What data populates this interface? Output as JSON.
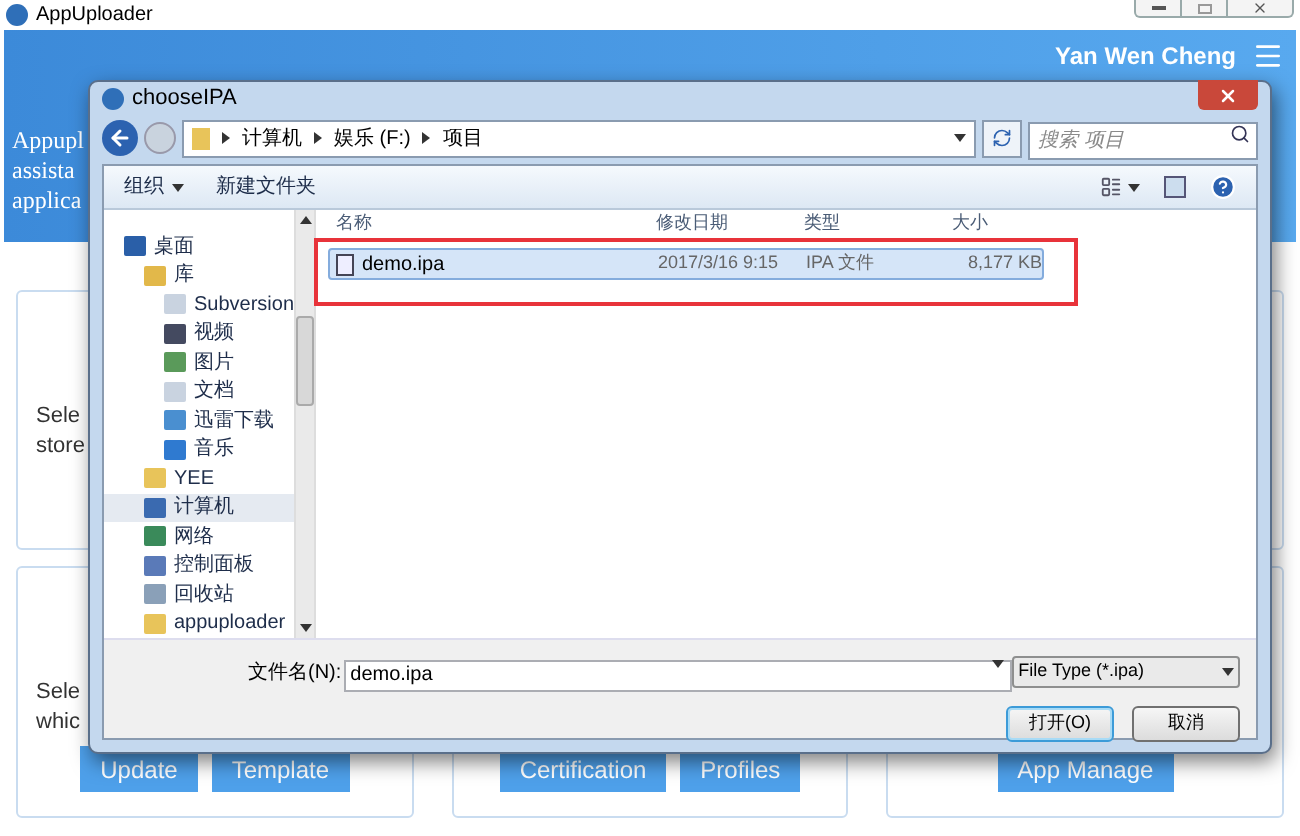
{
  "app": {
    "title": "AppUploader",
    "user": "Yan Wen Cheng",
    "intro_lines": [
      "Appupl",
      "assista",
      "applica"
    ],
    "rows": [
      {
        "cards": [
          {
            "lines": [
              "Sele",
              "store"
            ]
          }
        ]
      },
      {
        "cards": [
          {
            "lines": [
              "Sele",
              "whic"
            ],
            "buttons": [
              "Update",
              "Template"
            ]
          },
          {
            "buttons": [
              "Certification",
              "Profiles"
            ]
          },
          {
            "buttons": [
              "App Manage"
            ]
          }
        ]
      }
    ]
  },
  "dialog": {
    "title": "chooseIPA",
    "path": [
      "计算机",
      "娱乐 (F:)",
      "项目"
    ],
    "search_placeholder": "搜索 项目",
    "toolbar": [
      {
        "label": "组织",
        "kind": "menu"
      },
      {
        "label": "新建文件夹",
        "kind": "button"
      }
    ],
    "nav": [
      {
        "label": "桌面",
        "kind": "desktop",
        "selected": false,
        "children": [
          {
            "label": "库",
            "kind": "library",
            "selected": false,
            "children": [
              {
                "label": "Subversion",
                "kind": "document",
                "selected": false
              },
              {
                "label": "视频",
                "kind": "video",
                "selected": false
              },
              {
                "label": "图片",
                "kind": "picture",
                "selected": false
              },
              {
                "label": "文档",
                "kind": "document",
                "selected": false
              },
              {
                "label": "迅雷下载",
                "kind": "download",
                "selected": false
              },
              {
                "label": "音乐",
                "kind": "music",
                "selected": false
              }
            ]
          },
          {
            "label": "YEE",
            "kind": "folder",
            "selected": false
          },
          {
            "label": "计算机",
            "kind": "computer",
            "selected": true
          },
          {
            "label": "网络",
            "kind": "network",
            "selected": false
          },
          {
            "label": "控制面板",
            "kind": "control-panel",
            "selected": false
          },
          {
            "label": "回收站",
            "kind": "recycle-bin",
            "selected": false
          },
          {
            "label": "appuploader",
            "kind": "folder",
            "selected": false
          }
        ]
      }
    ],
    "columns": [
      "名称",
      "修改日期",
      "类型",
      "大小"
    ],
    "files": [
      {
        "name": "demo.ipa",
        "modified": "2017/3/16 9:15",
        "type": "IPA 文件",
        "size": "8,177 KB",
        "selected": true
      }
    ],
    "filename_label": "文件名(N):",
    "filename": "demo.ipa",
    "filetype": "File Type (*.ipa)",
    "buttons": [
      {
        "label": "打开(O)",
        "default": true
      },
      {
        "label": "取消",
        "default": false
      }
    ]
  }
}
